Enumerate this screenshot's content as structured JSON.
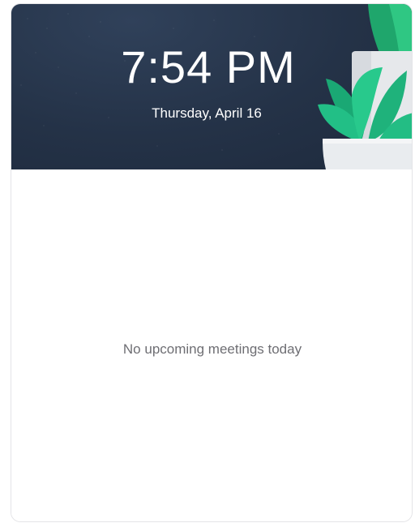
{
  "clock": {
    "time": "7:54 PM",
    "date": "Thursday, April 16"
  },
  "meetings": {
    "empty_message": "No upcoming meetings today"
  },
  "colors": {
    "header_bg": "#243247",
    "plant_green": "#1fb87a",
    "pot": "#e9ecef"
  },
  "icons": {
    "decoration": "potted-plant-illustration"
  }
}
